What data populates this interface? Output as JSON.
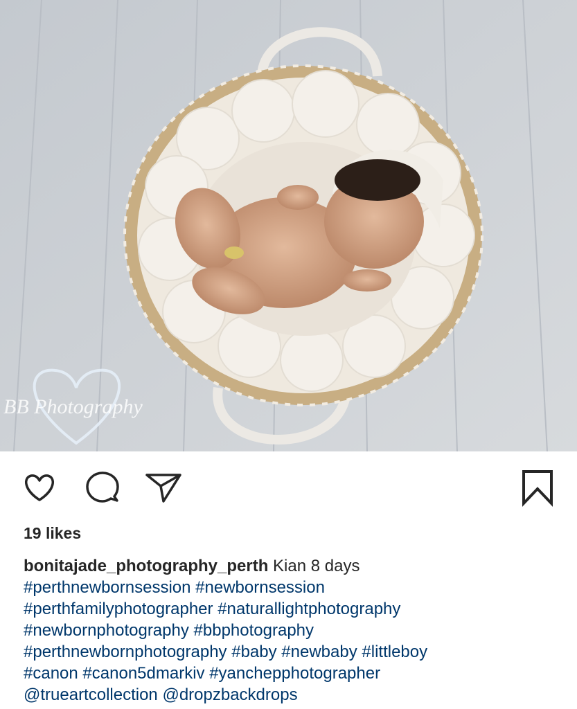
{
  "post": {
    "watermark": "BB Photography",
    "likes": "19 likes",
    "username": "bonitajade_photography_perth",
    "caption_text": "Kian 8 days",
    "tag_lines": [
      [
        "#perthnewbornsession",
        "#newbornsession"
      ],
      [
        "#perthfamilyphotographer",
        "#naturallightphotography"
      ],
      [
        "#newbornphotography",
        "#bbphotography"
      ],
      [
        "#perthnewbornphotography",
        "#baby",
        "#newbaby",
        "#littleboy"
      ],
      [
        "#canon",
        "#canon5dmarkiv",
        "#yanchepphotographer"
      ],
      [
        "@trueartcollection",
        "@dropzbackdrops"
      ]
    ]
  },
  "icons": {
    "like": "heart-icon",
    "comment": "comment-icon",
    "share": "paper-plane-icon",
    "save": "bookmark-icon"
  },
  "colors": {
    "text": "#262626",
    "hashtag": "#00376b",
    "background": "#ffffff"
  }
}
